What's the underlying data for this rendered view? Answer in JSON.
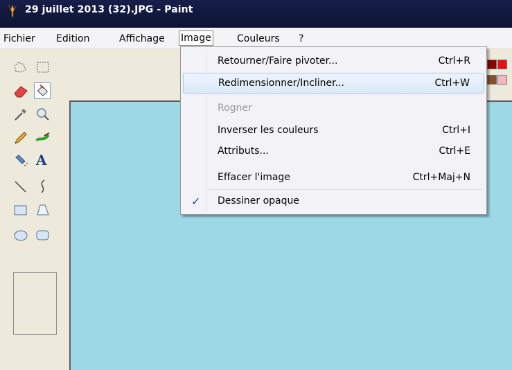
{
  "window": {
    "title": "29 juillet 2013 (32).JPG - Paint"
  },
  "menubar": {
    "items": [
      {
        "label": "Fichier"
      },
      {
        "label": "Edition"
      },
      {
        "label": "Affichage"
      },
      {
        "label": "Image"
      },
      {
        "label": "Couleurs"
      },
      {
        "label": "?"
      }
    ]
  },
  "image_menu": {
    "items": [
      {
        "label": "Retourner/Faire pivoter...",
        "shortcut": "Ctrl+R"
      },
      {
        "label": "Redimensionner/Incliner...",
        "shortcut": "Ctrl+W"
      },
      {
        "label": "Rogner",
        "shortcut": ""
      },
      {
        "label": "Inverser les couleurs",
        "shortcut": "Ctrl+I"
      },
      {
        "label": "Attributs...",
        "shortcut": "Ctrl+E"
      },
      {
        "label": "Effacer l'image",
        "shortcut": "Ctrl+Maj+N"
      },
      {
        "label": "Dessiner opaque",
        "shortcut": ""
      }
    ],
    "checkmark": "✓"
  },
  "toolbox": {
    "text_tool_glyph": "A"
  },
  "colors": {
    "canvas": "#9dd8e7",
    "palette_red_dark": "#8b0000",
    "palette_red": "#e81010",
    "palette_brown": "#8a4e2a",
    "palette_pink": "#f7b6c0"
  }
}
